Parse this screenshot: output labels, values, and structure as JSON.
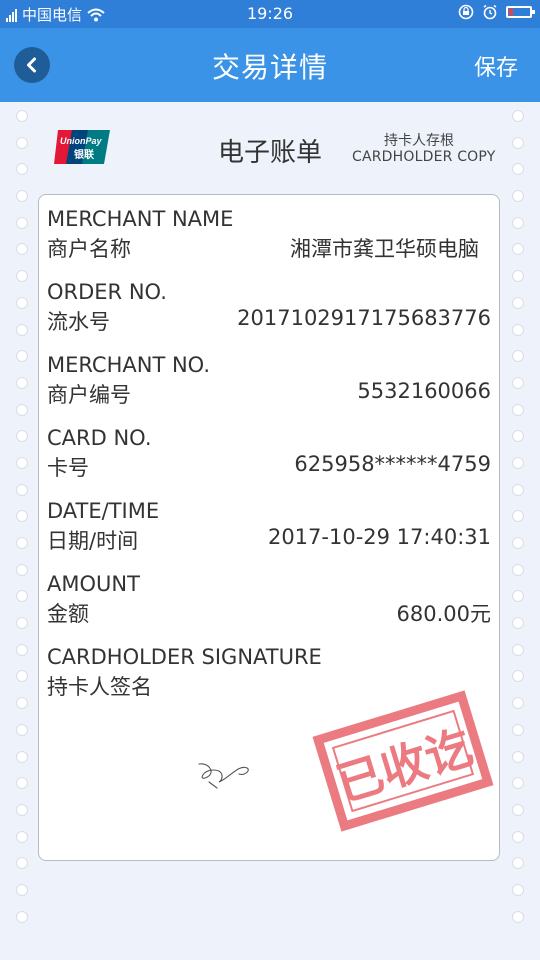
{
  "status_bar": {
    "carrier": "中国电信",
    "time": "19:26",
    "battery_level": 0.2,
    "icons": [
      "signal-icon",
      "wifi-icon",
      "lock-rotation-icon",
      "alarm-icon",
      "battery-icon"
    ]
  },
  "header": {
    "title": "交易详情",
    "save_label": "保存",
    "back_icon": "chevron-left-icon",
    "bg_color": "#3a93e6"
  },
  "receipt": {
    "brand_logo": "UnionPay 银联",
    "title": "电子账单",
    "copy_label_cn": "持卡人存根",
    "copy_label_en": "CARDHOLDER COPY",
    "fields": [
      {
        "label_en": "MERCHANT NAME",
        "label_cn": "商户名称",
        "value": "湘潭市龚卫华硕电脑"
      },
      {
        "label_en": "ORDER NO.",
        "label_cn": "流水号",
        "value": "2017102917175683776"
      },
      {
        "label_en": "MERCHANT NO.",
        "label_cn": "商户编号",
        "value": "5532160066"
      },
      {
        "label_en": "CARD NO.",
        "label_cn": "卡号",
        "value": "625958******4759"
      },
      {
        "label_en": "DATE/TIME",
        "label_cn": "日期/时间",
        "value": "2017-10-29 17:40:31"
      },
      {
        "label_en": "AMOUNT",
        "label_cn": "金额",
        "value": "680.00元"
      }
    ],
    "signature_label_en": "CARDHOLDER SIGNATURE",
    "signature_label_cn": "持卡人签名",
    "stamp_text": "已收讫",
    "stamp_color": "#e8656c"
  }
}
